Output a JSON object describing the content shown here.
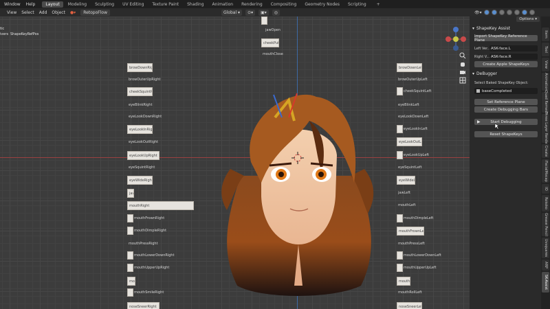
{
  "topbar": {
    "menus": [
      "Window",
      "Help"
    ],
    "workspaces": [
      "Layout",
      "Modeling",
      "Sculpting",
      "UV Editing",
      "Texture Paint",
      "Shading",
      "Animation",
      "Rendering",
      "Compositing",
      "Geometry Nodes",
      "Scripting"
    ],
    "active_workspace": "Layout",
    "plus": "+"
  },
  "header": {
    "menus": [
      "View",
      "Select",
      "Add",
      "Object"
    ],
    "addon": "RetopoFlow",
    "orientation": "Global",
    "options": "Options"
  },
  "viewport": {
    "overlay_text": [
      "tic",
      "ivers",
      "ShapeKeyRefPos"
    ]
  },
  "shapekeys_left": [
    "browDownRight",
    "browOuterUpRight",
    "cheekSquintRight",
    "eyeBlinkRight",
    "eyeLookDownRight",
    "eyeLookInRight",
    "eyeLookOutRight",
    "eyeLookUpRight",
    "eyeSquintRight",
    "eyeWideRight",
    "jawRight",
    "mouthRight",
    "mouthFrownRight",
    "mouthDimpleRight",
    "mouthPressRight",
    "mouthLowerDownRight",
    "mouthUpperUpRight",
    "mouthRollRight",
    "mouthSmileRight",
    "noseSneerRight"
  ],
  "shapekeys_right": [
    "browDownLeft",
    "browOuterUpLeft",
    "cheekSquintLeft",
    "eyeBlinkLeft",
    "eyeLookDownLeft",
    "eyeLookInLeft",
    "eyeLookOutLeft",
    "eyeLookUpLeft",
    "eyeSquintLeft",
    "eyeWideLeft",
    "jawLeft",
    "mouthLeft",
    "mouthFrownLeft",
    "mouthDimpleLeft",
    "mouthPressLeft",
    "mouthLowerDownLeft",
    "mouthUpperUpLeft",
    "mouthRollLeft",
    "mouthSmileLeft",
    "noseSneerLeft"
  ],
  "shapekeys_center": [
    "jawOpen",
    "mouthClose",
    "cheekPuff"
  ],
  "panel": {
    "assist_title": "ShapeKey Assist",
    "import_btn": "Import ShapeKey Reference Plane",
    "left_label": "Left Ver...",
    "left_value": "ASK-face.L",
    "right_label": "Right V...",
    "right_value": "ASK-face.R",
    "apple_btn": "Create Apple ShapeKeys",
    "debugger_title": "DeBugger",
    "select_label": "Select Baked ShapeKey Object:",
    "select_value": "baseCompleted",
    "set_ref_btn": "Set Reference Plane",
    "create_bars_btn": "Create Debugging Bars",
    "start_btn": "Start Debugging",
    "reset_btn": "Reset ShapeKeys"
  },
  "tabs": [
    "Item",
    "Tool",
    "View",
    "Animation",
    "Quad Remesh",
    "Three Layer Render",
    "Create",
    "iFacialMocap",
    "IO",
    "Rokoko",
    "Grease Pencil",
    "Uvsquares",
    "ARP",
    "SK-Assist"
  ],
  "active_tab": "SK-Assist",
  "colors": {
    "accent": "#4772b3",
    "x_axis": "#9b4040",
    "y_axis": "#3e6aa5"
  }
}
